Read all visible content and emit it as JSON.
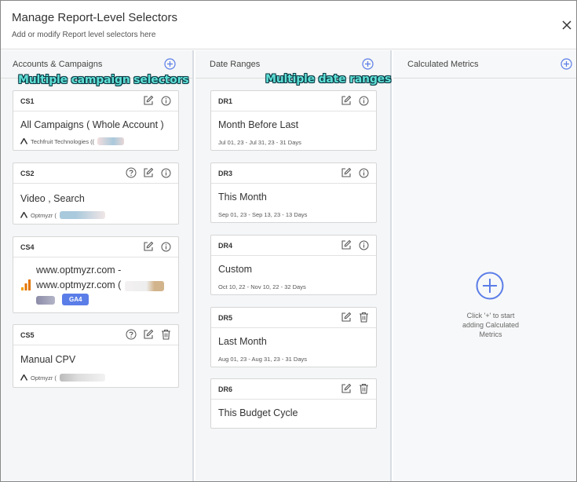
{
  "header": {
    "title": "Manage Report-Level Selectors",
    "subtitle": "Add or modify Report level selectors here"
  },
  "columns": {
    "campaigns": {
      "title": "Accounts & Campaigns",
      "annotation": "Multiple campaign selectors"
    },
    "dates": {
      "title": "Date Ranges",
      "annotation": "Multiple date ranges"
    },
    "metrics": {
      "title": "Calculated Metrics",
      "empty_text": "Click '+' to start adding Calculated Metrics"
    }
  },
  "campaign_cards": [
    {
      "id": "CS1",
      "title": "All Campaigns ( Whole Account )",
      "account": "Techfruit Technologies (("
    },
    {
      "id": "CS2",
      "title": "Video , Search",
      "account": "Optmyzr ("
    },
    {
      "id": "CS4",
      "line1": "www.optmyzr.com -",
      "line2": "www.optmyzr.com (",
      "badge": "GA4"
    },
    {
      "id": "CS5",
      "title": "Manual CPV",
      "account": "Optmyzr ("
    }
  ],
  "date_cards": [
    {
      "id": "DR1",
      "title": "Month Before Last",
      "range": "Jul 01, 23  -  Jul 31, 23 - 31 Days"
    },
    {
      "id": "DR3",
      "title": "This Month",
      "range": "Sep 01, 23  -  Sep 13, 23 - 13 Days"
    },
    {
      "id": "DR4",
      "title": "Custom",
      "range": "Oct 10, 22  -  Nov 10, 22 - 32 Days"
    },
    {
      "id": "DR5",
      "title": "Last Month",
      "range": "Aug 01, 23  -  Aug 31, 23 - 31 Days"
    },
    {
      "id": "DR6",
      "title": "This Budget Cycle"
    }
  ],
  "colors": {
    "accent": "#5b7de8",
    "annotation": "#5fe0d6"
  }
}
